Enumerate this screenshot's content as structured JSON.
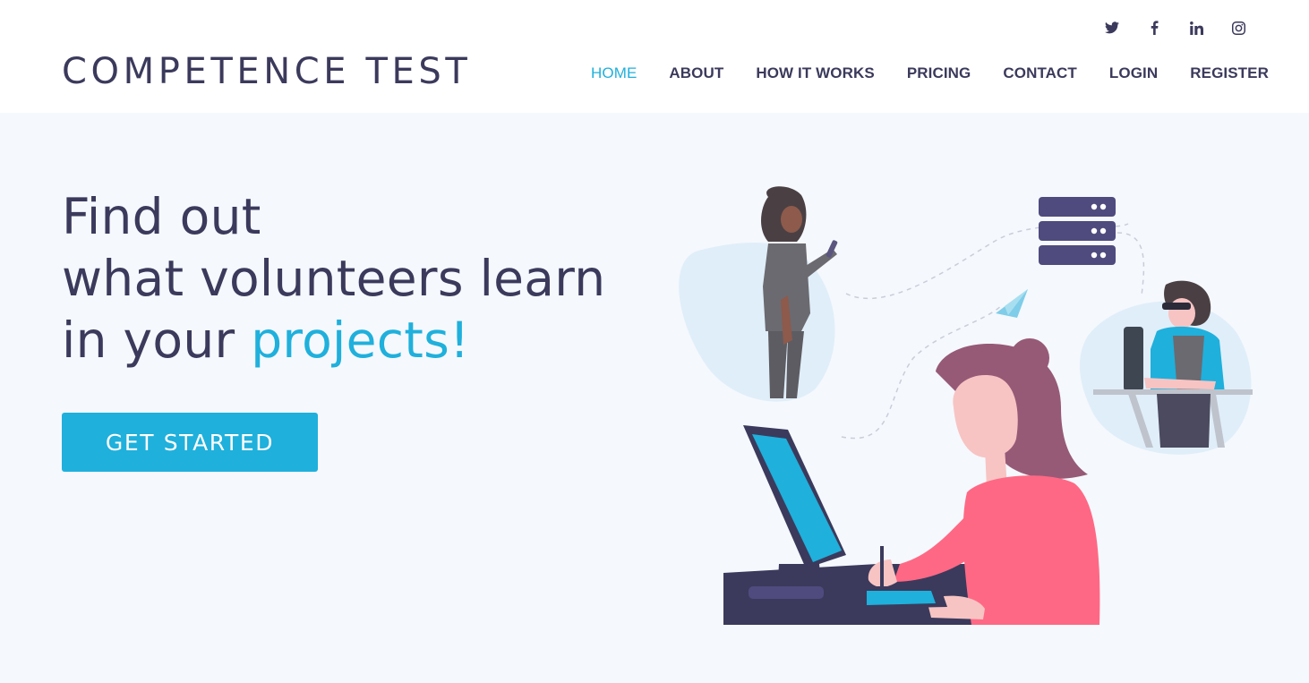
{
  "header": {
    "logo": "COMPETENCE TEST",
    "social": [
      {
        "icon": "twitter-icon"
      },
      {
        "icon": "facebook-icon"
      },
      {
        "icon": "linkedin-icon"
      },
      {
        "icon": "instagram-icon"
      }
    ],
    "nav": [
      {
        "label": "HOME",
        "active": true
      },
      {
        "label": "ABOUT",
        "active": false
      },
      {
        "label": "HOW IT WORKS",
        "active": false
      },
      {
        "label": "PRICING",
        "active": false
      },
      {
        "label": "CONTACT",
        "active": false
      },
      {
        "label": "LOGIN",
        "active": false
      },
      {
        "label": "REGISTER",
        "active": false
      }
    ]
  },
  "hero": {
    "line1": "Find out",
    "line2": "what volunteers learn",
    "line3_prefix": "in your ",
    "line3_accent": "projects!",
    "cta_label": "GET STARTED"
  },
  "colors": {
    "accent": "#1fb0dc",
    "text": "#3b3a5c",
    "background": "#f5f8fd",
    "header_bg": "#ffffff"
  }
}
